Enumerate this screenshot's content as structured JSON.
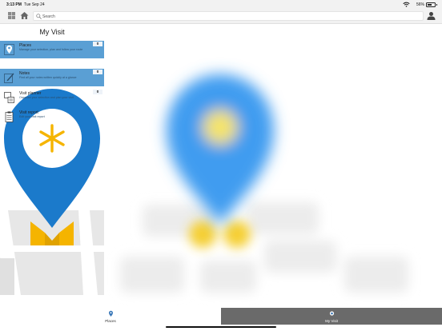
{
  "status_bar": {
    "time": "3:13 PM",
    "date": "Tue Sep 24",
    "battery_percent": "56%",
    "battery_level": 0.56
  },
  "toolbar": {
    "search_placeholder": "Search",
    "icons": [
      "grid-icon",
      "home-icon",
      "search-icon",
      "user-icon"
    ]
  },
  "panel": {
    "title": "My Visit",
    "items": [
      {
        "title": "Places",
        "description": "Manage your selection, plan and follow your route",
        "count": "0",
        "icon": "map-pin-icon",
        "active": true
      },
      {
        "title": "Notes",
        "description": "Find all your notes written quickly at a glance",
        "count": "0",
        "icon": "pencil-icon",
        "active": true
      },
      {
        "title": "Visit planner",
        "description": "Organise your selection and plan your visit",
        "count": "0",
        "icon": "planner-icon",
        "active": false
      },
      {
        "title": "Visit report",
        "description": "Edit your visit report",
        "count": "",
        "icon": "clipboard-icon",
        "active": false
      }
    ]
  },
  "tabs": [
    {
      "label": "Places",
      "icon": "map-pin-icon",
      "selected": false
    },
    {
      "label": "My Visit",
      "icon": "dot-icon",
      "selected": true
    }
  ],
  "colors": {
    "accent_blue": "#5a9fd4",
    "pin_blue": "#1b7acb",
    "pin_yellow": "#f5b400",
    "selected_tab": "#6a6a6a",
    "toolbar_bg": "#f2f2f2"
  }
}
